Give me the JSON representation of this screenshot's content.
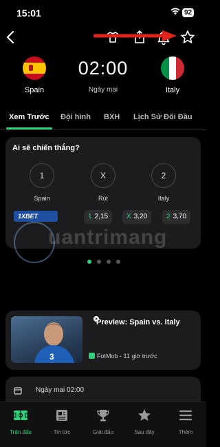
{
  "status": {
    "time": "15:01",
    "battery": "92"
  },
  "match": {
    "home": {
      "name": "Spain"
    },
    "away": {
      "name": "Italy"
    },
    "kickoff": "02:00",
    "day": "Ngày mai"
  },
  "tabs": [
    {
      "label": "Xem Trước"
    },
    {
      "label": "Đội hình"
    },
    {
      "label": "BXH"
    },
    {
      "label": "Lịch Sử Đối Đầu"
    }
  ],
  "prediction": {
    "question": "Ai sẽ chiến thắng?",
    "options": [
      {
        "symbol": "1",
        "label": "Spain"
      },
      {
        "symbol": "X",
        "label": "Rút"
      },
      {
        "symbol": "2",
        "label": "Italy"
      }
    ],
    "bookmaker": "1XBET",
    "odds": [
      {
        "key": "1",
        "value": "2,15"
      },
      {
        "key": "X",
        "value": "3,20"
      },
      {
        "key": "2",
        "value": "3,70"
      }
    ],
    "pages": 4,
    "active_page": 1
  },
  "watermark": "uantrimang",
  "news": {
    "title": "Preview: Spain vs. Italy",
    "source": "FotMob - 11 giờ trước"
  },
  "schedule": {
    "time": "Ngày mai 02:00"
  },
  "bottom_nav": [
    {
      "label": "Trận đấu",
      "icon": "pitch-icon"
    },
    {
      "label": "Tin tức",
      "icon": "news-icon"
    },
    {
      "label": "Giải đấu",
      "icon": "trophy-icon"
    },
    {
      "label": "Sau đây",
      "icon": "star-icon"
    },
    {
      "label": "Thêm",
      "icon": "menu-icon"
    }
  ],
  "colors": {
    "accent": "#2fd27a",
    "card": "#1c1c1e",
    "annotation": "#e0241b"
  }
}
